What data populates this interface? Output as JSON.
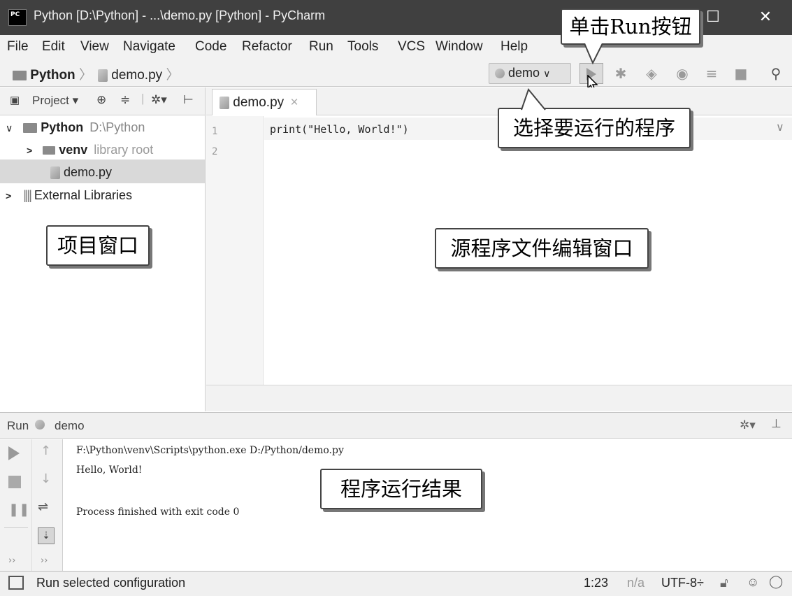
{
  "window": {
    "title": "Python [D:\\Python] - ...\\demo.py [Python] - PyCharm",
    "logo": "PC",
    "close": "✕",
    "maximize": "☐"
  },
  "menu": [
    {
      "label": "File"
    },
    {
      "label": "Edit"
    },
    {
      "label": "View"
    },
    {
      "label": "Navigate"
    },
    {
      "label": "Code"
    },
    {
      "label": "Refactor"
    },
    {
      "label": "Run"
    },
    {
      "label": "Tools"
    },
    {
      "label": "VCS"
    },
    {
      "label": "Window"
    },
    {
      "label": "Help"
    }
  ],
  "breadcrumb": {
    "project": "Python",
    "file": "demo.py",
    "sep": "〉"
  },
  "toolbar": {
    "config": "demo",
    "config_arrow": "∨"
  },
  "project_panel": {
    "header": "Project",
    "header_arrow": "▾",
    "root_name": "Python",
    "root_path": "D:\\Python",
    "venv_name": "venv",
    "venv_hint": "library root",
    "file": "demo.py",
    "ext": "External Libraries"
  },
  "editor": {
    "tab": "demo.py",
    "tab_close": "×",
    "line1": "1",
    "line2": "2",
    "code": "print(\"Hello, World!\")",
    "check": "∨"
  },
  "run_panel": {
    "label": "Run",
    "config": "demo",
    "line1": "F:\\Python\\venv\\Scripts\\python.exe D:/Python/demo.py",
    "line2": "Hello, World!",
    "line3": "Process finished with exit code 0",
    "more": "››"
  },
  "status": {
    "message": "Run selected configuration",
    "position": "1:23",
    "na": "n/a",
    "encoding": "UTF-8÷"
  },
  "callouts": {
    "run_button": "单击Run按钮",
    "choose_program": "选择要运行的程序",
    "project_window": "项目窗口",
    "editor_window": "源程序文件编辑窗口",
    "run_result": "程序运行结果"
  }
}
